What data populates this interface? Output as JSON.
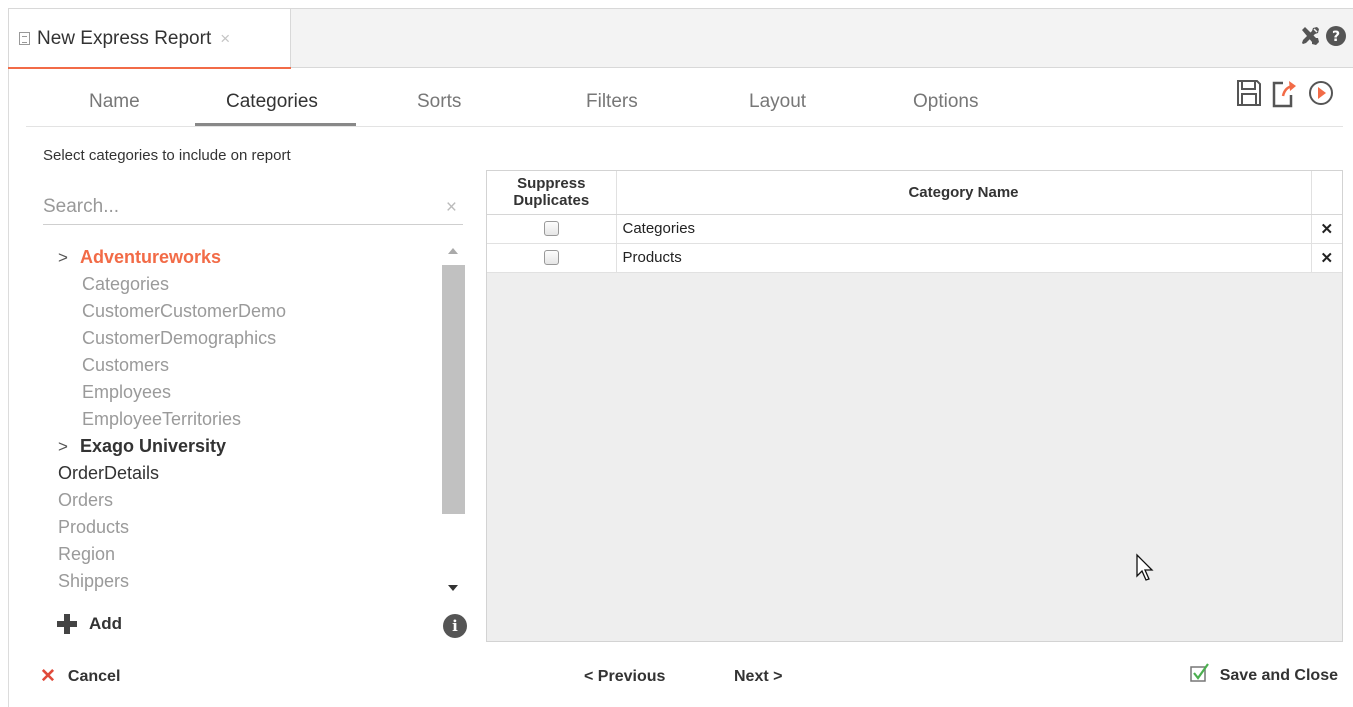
{
  "document_tab": {
    "title": "New Express Report",
    "close_glyph": "×"
  },
  "tabs": [
    {
      "label": "Name",
      "active": false
    },
    {
      "label": "Categories",
      "active": true
    },
    {
      "label": "Sorts",
      "active": false
    },
    {
      "label": "Filters",
      "active": false
    },
    {
      "label": "Layout",
      "active": false
    },
    {
      "label": "Options",
      "active": false
    }
  ],
  "top_icons": [
    "tools-icon",
    "help-icon"
  ],
  "action_icons": [
    "save-icon",
    "export-icon",
    "run-icon"
  ],
  "left_panel": {
    "instruction": "Select categories to include on report",
    "search": {
      "placeholder": "Search...",
      "value": ""
    },
    "tree": [
      {
        "label": "Adventureworks",
        "type": "folder",
        "color": "#f26b47"
      },
      {
        "label": "Categories",
        "type": "item"
      },
      {
        "label": "CustomerCustomerDemo",
        "type": "item"
      },
      {
        "label": "CustomerDemographics",
        "type": "item"
      },
      {
        "label": "Customers",
        "type": "item"
      },
      {
        "label": "Employees",
        "type": "item"
      },
      {
        "label": "EmployeeTerritories",
        "type": "item"
      },
      {
        "label": "Exago University",
        "type": "folder"
      },
      {
        "label": "OrderDetails",
        "type": "item",
        "emphasis": "dark"
      },
      {
        "label": "Orders",
        "type": "item"
      },
      {
        "label": "Products",
        "type": "item"
      },
      {
        "label": "Region",
        "type": "item"
      },
      {
        "label": "Shippers",
        "type": "item"
      }
    ],
    "add_label": "Add"
  },
  "grid": {
    "headers": {
      "suppress_line1": "Suppress",
      "suppress_line2": "Duplicates",
      "category_name": "Category Name"
    },
    "rows": [
      {
        "suppress": false,
        "category": "Categories"
      },
      {
        "suppress": false,
        "category": "Products"
      }
    ]
  },
  "footer": {
    "cancel": "Cancel",
    "previous": "Previous",
    "next": "Next",
    "save_and_close": "Save and Close"
  },
  "colors": {
    "accent": "#f26b47",
    "delete": "#e04a3a",
    "save_check": "#4caf50"
  }
}
